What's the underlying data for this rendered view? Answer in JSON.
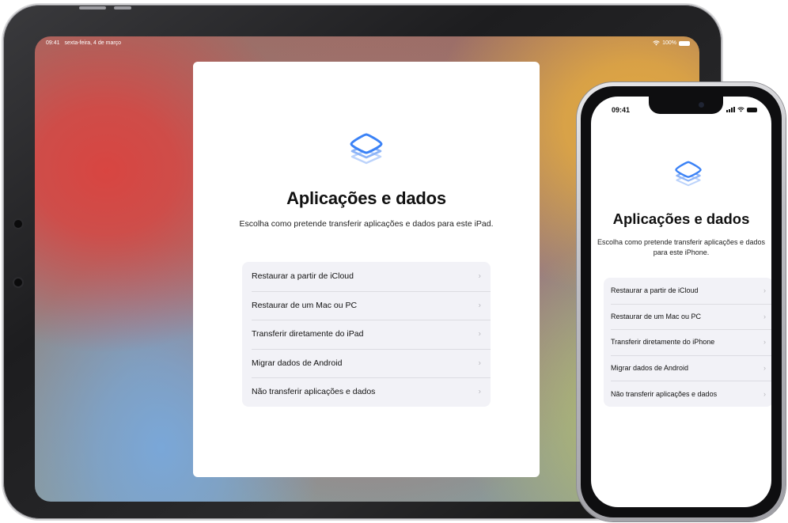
{
  "ipad": {
    "status": {
      "time": "09:41",
      "date": "sexta-feira, 4 de março",
      "battery": "100%"
    },
    "title": "Aplicações e dados",
    "subtitle": "Escolha como pretende transferir aplicações e dados para este iPad.",
    "options": [
      {
        "label": "Restaurar a partir de iCloud"
      },
      {
        "label": "Restaurar de um Mac ou PC"
      },
      {
        "label": "Transferir diretamente do iPad"
      },
      {
        "label": "Migrar dados de Android"
      },
      {
        "label": "Não transferir aplicações e dados"
      }
    ]
  },
  "iphone": {
    "status": {
      "time": "09:41"
    },
    "title": "Aplicações e dados",
    "subtitle": "Escolha como pretende transferir aplicações e dados para este iPhone.",
    "options": [
      {
        "label": "Restaurar a partir de iCloud"
      },
      {
        "label": "Restaurar de um Mac ou PC"
      },
      {
        "label": "Transferir diretamente do iPhone"
      },
      {
        "label": "Migrar dados de Android"
      },
      {
        "label": "Não transferir aplicações e dados"
      }
    ]
  },
  "icons": {
    "app_data": "stacked-layers-icon",
    "chevron": "chevron-right-icon",
    "wifi": "wifi-icon",
    "battery": "battery-icon",
    "signal": "cellular-signal-icon"
  },
  "colors": {
    "accent": "#3b82f6",
    "list_background": "#f2f2f7",
    "chevron": "#b7b7bd"
  }
}
